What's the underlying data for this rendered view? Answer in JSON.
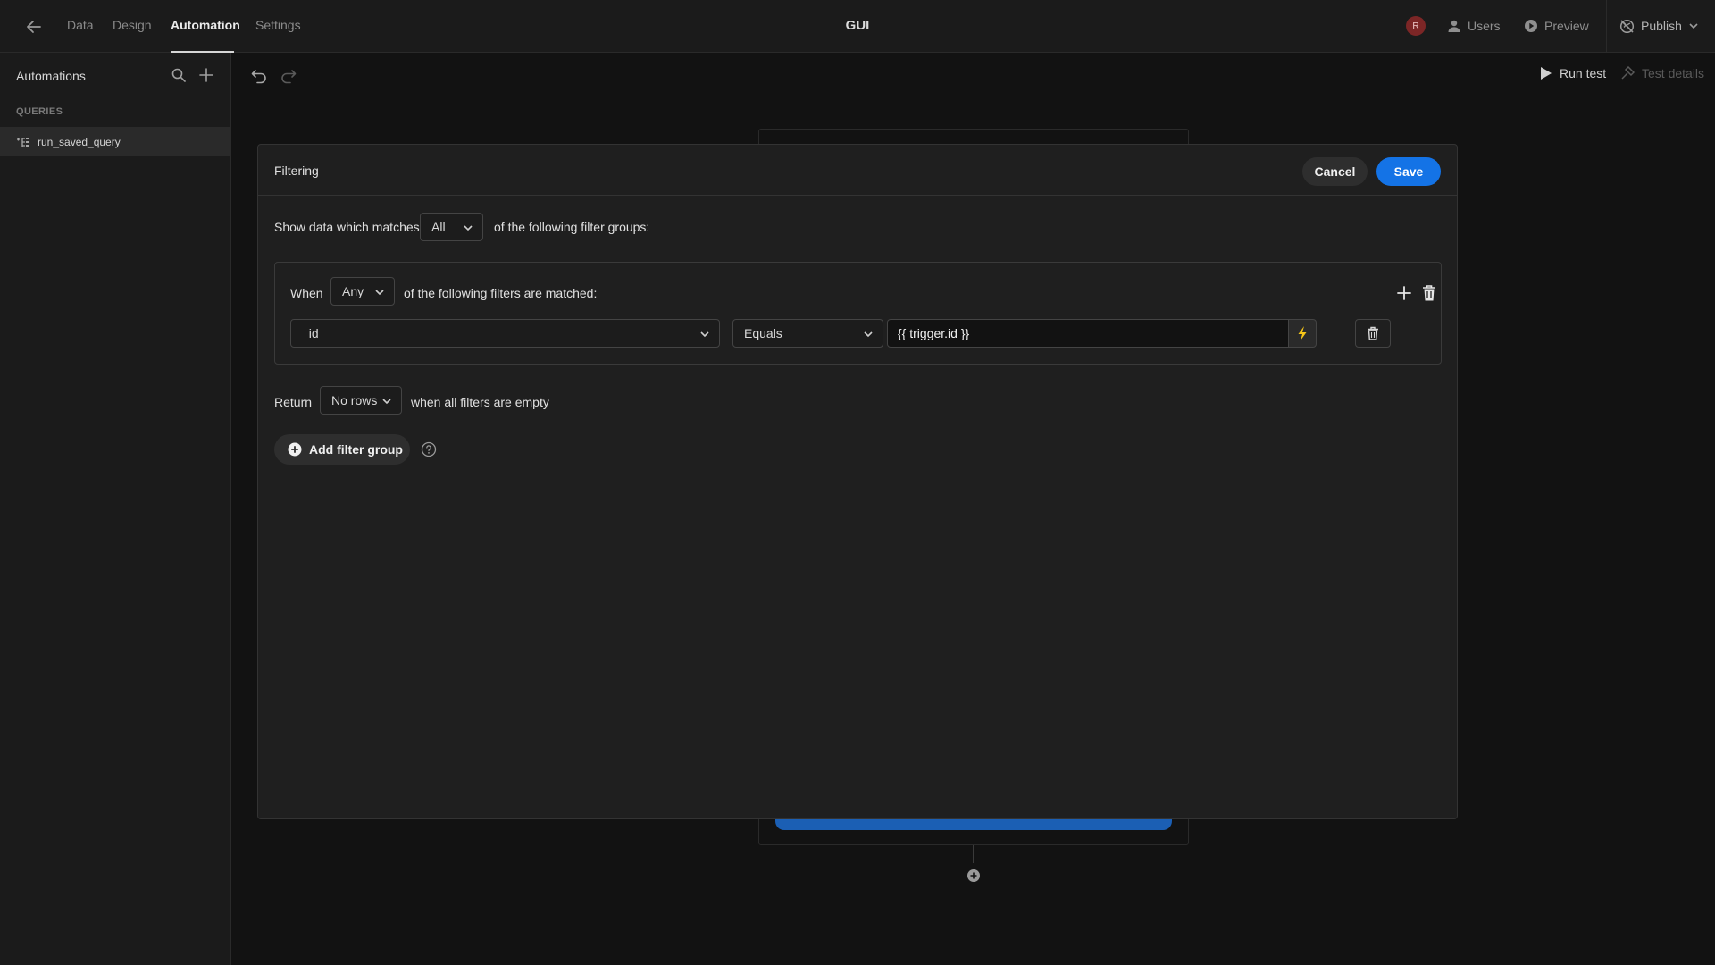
{
  "topbar": {
    "tabs": [
      {
        "label": "Data"
      },
      {
        "label": "Design"
      },
      {
        "label": "Automation"
      },
      {
        "label": "Settings"
      }
    ],
    "app_title": "GUI",
    "avatar_initial": "R",
    "users_label": "Users",
    "preview_label": "Preview",
    "publish_label": "Publish"
  },
  "sidebar": {
    "title": "Automations",
    "section_label": "QUERIES",
    "items": [
      {
        "label": "run_saved_query"
      }
    ]
  },
  "canvas": {
    "run_test_label": "Run test",
    "test_details_label": "Test details"
  },
  "modal": {
    "title": "Filtering",
    "cancel_label": "Cancel",
    "save_label": "Save",
    "show_prefix": "Show data which matches",
    "match_mode": "All",
    "show_suffix": "of the following filter groups:",
    "group": {
      "when_label": "When",
      "group_mode": "Any",
      "group_suffix": "of the following filters are matched:",
      "filter": {
        "field": "_id",
        "operator": "Equals",
        "value": "{{ trigger.id }}"
      }
    },
    "return_label": "Return",
    "return_value": "No rows",
    "return_suffix": "when all filters are empty",
    "add_group_label": "Add filter group"
  },
  "colors": {
    "accent": "#1473e6",
    "binding_icon": "#f5c518",
    "avatar_bg": "#7c2626"
  }
}
